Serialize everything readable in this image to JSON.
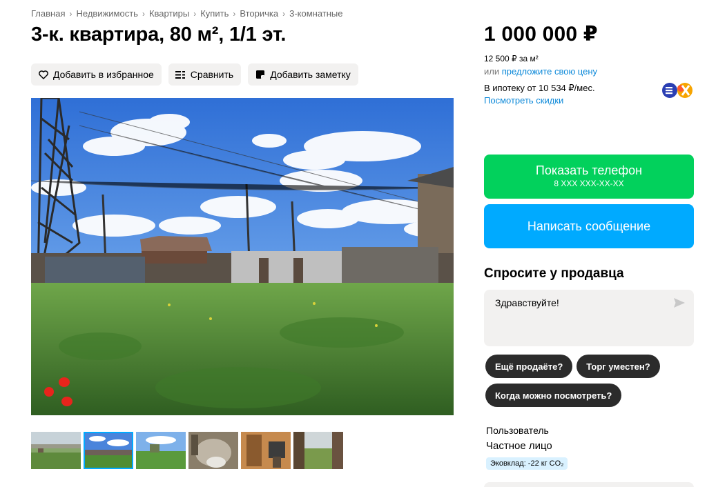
{
  "breadcrumb": [
    "Главная",
    "Недвижимость",
    "Квартиры",
    "Купить",
    "Вторичка",
    "3-комнатные"
  ],
  "listing": {
    "title": "3-к. квартира, 80 м², 1/1 эт."
  },
  "actions": {
    "favorite_label": "Добавить в избранное",
    "compare_label": "Сравнить",
    "note_label": "Добавить заметку"
  },
  "gallery": {
    "thumb_count": 6,
    "active_index": 1
  },
  "price": {
    "value": "1 000 000 ₽",
    "per_m2": "12 500 ₽ за м²",
    "offer_prefix": "или",
    "offer_link": "предложите свою цену",
    "mortgage": "В ипотеку от 10 534 ₽/мес.",
    "discounts_link": "Посмотреть скидки",
    "bank_icon": "bank-logo-icon"
  },
  "contact": {
    "phone_label": "Показать телефон",
    "phone_masked": "8 XXX XXX-XX-XX",
    "message_label": "Написать сообщение"
  },
  "ask": {
    "title": "Спросите у продавца",
    "message_value": "Здравствуйте!",
    "quick_replies": [
      "Ещё продаёте?",
      "Торг уместен?",
      "Когда можно посмотреть?"
    ]
  },
  "seller": {
    "name": "Пользователь",
    "type": "Частное лицо",
    "eco_badge": "Эковклад: -22 кг CO₂"
  },
  "colors": {
    "phone_button": "#02d15c",
    "message_button": "#00aaff",
    "link": "#0a88d9",
    "chip": "#2b2b2b",
    "eco_badge": "#d9f1ff"
  }
}
